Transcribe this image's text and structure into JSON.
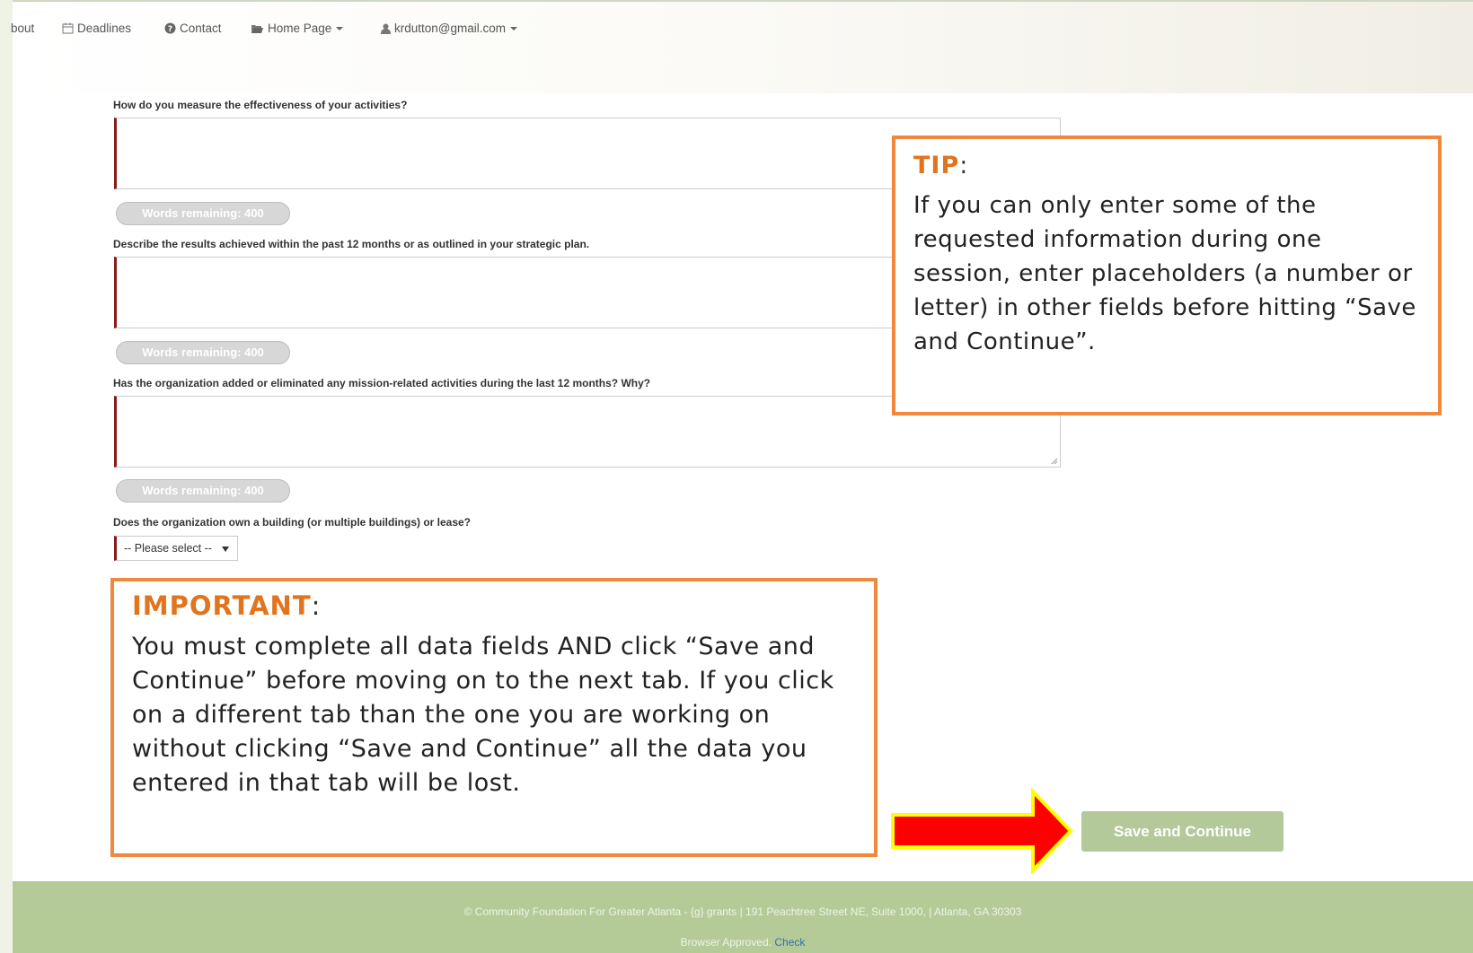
{
  "nav": {
    "about": "bout",
    "deadlines": "Deadlines",
    "contact": "Contact",
    "home_page": "Home Page",
    "user": "krdutton@gmail.com"
  },
  "form": {
    "q1": "How do you measure the effectiveness of your activities?",
    "q2": "Describe the results achieved within the past 12 months or as outlined in your strategic plan.",
    "q3": "Has the organization added or eliminated any mission-related activities during the last 12 months? Why?",
    "q4": "Does the organization own a building (or multiple buildings) or lease?",
    "words_remaining": "Words remaining: 400",
    "select_value": "-- Please select --",
    "save_button": "Save and Continue"
  },
  "tip": {
    "title": "TIP",
    "colon": ":",
    "body": "If you can only enter some of the requested information during one session, enter placeholders (a number or letter) in other fields before hitting “Save and Continue”."
  },
  "important": {
    "title": "IMPORTANT",
    "colon": ":",
    "body": "You must complete all data fields AND click “Save and Continue” before moving on to the next tab. If you click on a different tab than the one you are working on without clicking “Save and Continue” all the data you entered in that tab will be lost."
  },
  "footer": {
    "line1": "© Community Foundation For Greater Atlanta - {g} grants | 191 Peachtree Street NE, Suite 1000, | Atlanta, GA 30303",
    "approved": "Browser Approved.",
    "check": "Check"
  },
  "colors": {
    "callout_border": "#f0883d",
    "callout_title": "#e2741e",
    "button_bg": "#b3c99a",
    "footer_bg": "#b4cb98",
    "arrow_fill": "#ff0000",
    "arrow_outline": "#ffff00"
  }
}
